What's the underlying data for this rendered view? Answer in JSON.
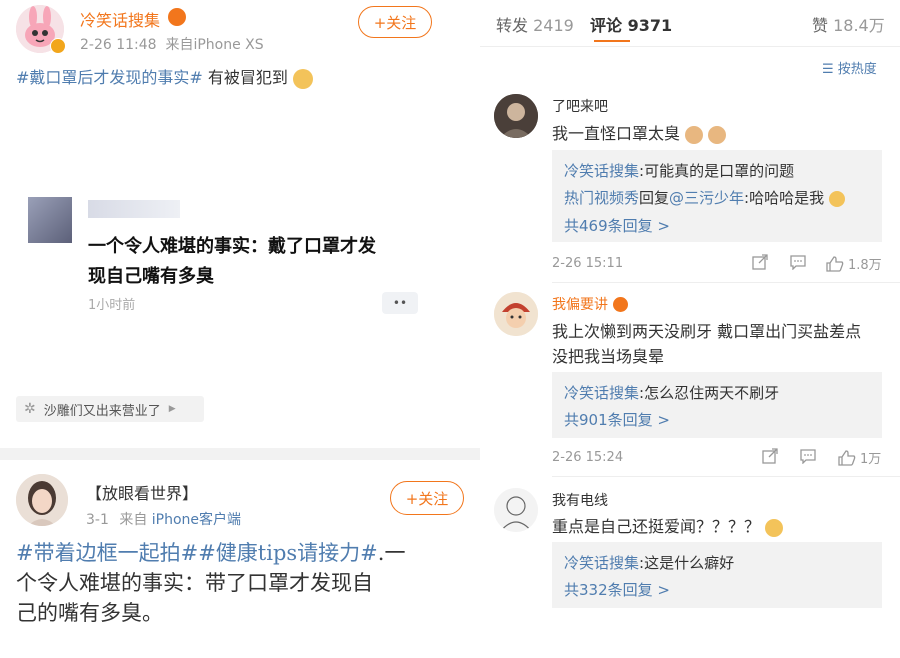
{
  "post1": {
    "author": "冷笑话搜集",
    "follow_label": "+关注",
    "meta": "2-26 11:48  来自iPhone XS",
    "hashtag": "#戴口罩后才发现的事实#",
    "text_suffix": " 有被冒犯到",
    "card_title_1": "一个令人难堪的事实：戴了口罩才发",
    "card_title_2": "现自己嘴有多臭",
    "card_time": "1小时前",
    "card_more": "••",
    "source": "沙雕们又出来营业了"
  },
  "post2": {
    "author": "【放眼看世界】",
    "follow_label": "+关注",
    "date": "3-1",
    "source_prefix": "来自",
    "source_app": "iPhone客户端",
    "hashtags": "#带着边框一起拍##健康tips请接力#",
    "text_1": ".一",
    "text_2": "个令人难堪的事实：带了口罩才发现自",
    "text_3": "己的嘴有多臭。"
  },
  "tabs": {
    "repost_label": "转发",
    "repost_count": "2419",
    "comment_label": "评论",
    "comment_count": "9371",
    "like_label": "赞",
    "like_count": "18.4万"
  },
  "sort_label": "按热度",
  "comments": [
    {
      "user": "了吧来吧",
      "text": "我一直怪口罩太臭",
      "replies": [
        {
          "user": "冷笑话搜集",
          "text": ":可能真的是口罩的问题"
        },
        {
          "user": "热门视频秀",
          "mid": "回复",
          "mention": "@三污少年",
          "text": ":哈哈哈是我"
        }
      ],
      "more": "共469条回复 >",
      "time": "2-26 15:11",
      "likes": "1.8万"
    },
    {
      "user": "我偏要讲",
      "text_1": "我上次懒到两天没刷牙 戴口罩出门买盐差点",
      "text_2": "没把我当场臭晕",
      "replies": [
        {
          "user": "冷笑话搜集",
          "text": ":怎么忍住两天不刷牙"
        }
      ],
      "more": "共901条回复 >",
      "time": "2-26 15:24",
      "likes": "1万"
    },
    {
      "user": "我有电线",
      "text": "重点是自己还挺爱闻？？？？",
      "replies": [
        {
          "user": "冷笑话搜集",
          "text": ":这是什么癖好"
        }
      ],
      "more": "共332条回复 >"
    }
  ],
  "colors": {
    "accent": "#f2761c",
    "link": "#507daf",
    "reply_bg": "#f2f2f2"
  }
}
